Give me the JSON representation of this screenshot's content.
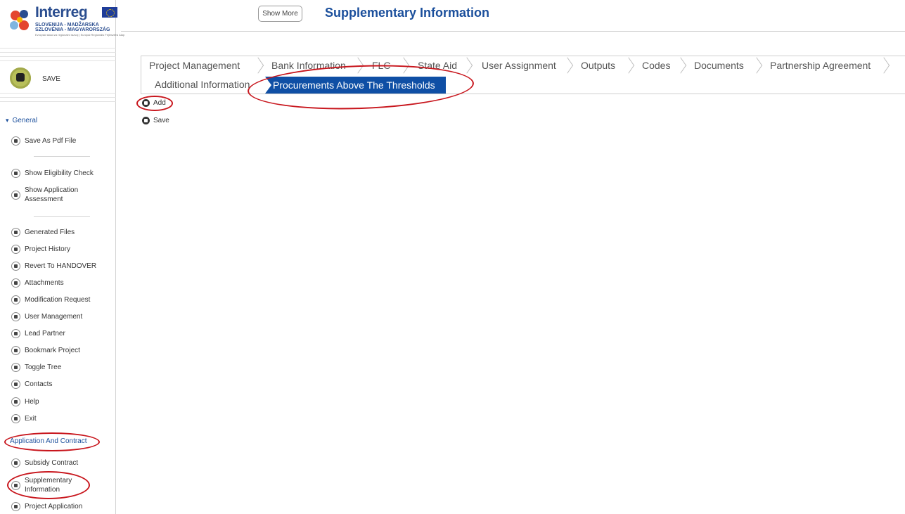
{
  "header": {
    "logo": {
      "word": "Interreg",
      "line1": "SLOVENIJA - MADŽARSKA",
      "line2": "SZLOVÉNIA - MAGYARORSZÁG",
      "line3": "Evropski sklad za regionalni razvoj | Európai Regionális Fejlesztési Alap"
    },
    "show_more_label": "Show More",
    "title": "Supplementary Information"
  },
  "sidebar": {
    "save_label": "SAVE",
    "general_label": "General",
    "items_group1": [
      {
        "label": "Save As Pdf File",
        "icon": "pdf-icon"
      }
    ],
    "items_group2": [
      {
        "label": "Show Eligibility Check",
        "icon": "flag-icon"
      },
      {
        "label": "Show Application Assessment",
        "icon": "flag-icon"
      }
    ],
    "items_group3": [
      {
        "label": "Generated Files",
        "icon": "file-icon"
      },
      {
        "label": "Project History",
        "icon": "history-icon"
      },
      {
        "label": "Revert To HANDOVER",
        "icon": "revert-icon"
      },
      {
        "label": "Attachments",
        "icon": "attachment-icon"
      },
      {
        "label": "Modification Request",
        "icon": "building-icon"
      },
      {
        "label": "User Management",
        "icon": "user-icon"
      },
      {
        "label": "Lead Partner",
        "icon": "user-icon"
      },
      {
        "label": "Bookmark Project",
        "icon": "bookmark-icon"
      },
      {
        "label": "Toggle Tree",
        "icon": "tree-icon"
      },
      {
        "label": "Contacts",
        "icon": "contacts-icon"
      },
      {
        "label": "Help",
        "icon": "help-icon"
      },
      {
        "label": "Exit",
        "icon": "exit-icon"
      }
    ],
    "app_contract_label": "Application And Contract",
    "items_group4": [
      {
        "label": "Subsidy Contract",
        "icon": "contract-icon"
      },
      {
        "label": "Supplementary Information",
        "icon": "info-icon"
      },
      {
        "label": "Project Application",
        "icon": "building-icon"
      }
    ]
  },
  "tabs": {
    "row1": [
      "Project Management",
      "Bank Information",
      "FLC",
      "State Aid",
      "User Assignment",
      "Outputs",
      "Codes",
      "Documents",
      "Partnership Agreement"
    ],
    "row2_inactive": "Additional Information",
    "row2_active": "Procurements Above The Thresholds"
  },
  "actions": {
    "add_label": "Add",
    "save_label": "Save"
  },
  "colors": {
    "accent": "#0f4fa5",
    "title": "#1b4f9c",
    "annotation": "#c8161d"
  }
}
